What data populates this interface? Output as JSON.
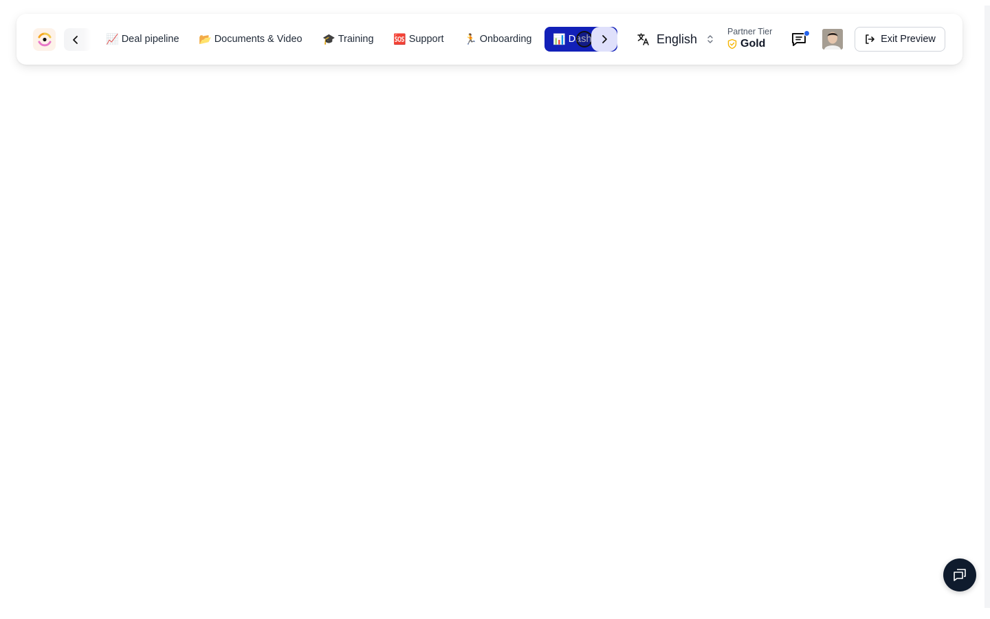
{
  "nav": {
    "items": [
      {
        "emoji": "📈",
        "label": "Deal pipeline",
        "icon": "chart-increasing-emoji"
      },
      {
        "emoji": "📂",
        "label": "Documents & Video",
        "icon": "folder-emoji"
      },
      {
        "emoji": "🎓",
        "label": "Training",
        "icon": "graduation-cap-emoji"
      },
      {
        "emoji": "🆘",
        "label": "Support",
        "icon": "sos-emoji"
      },
      {
        "emoji": "🏃",
        "label": "Onboarding",
        "icon": "runner-emoji"
      }
    ],
    "active": {
      "emoji": "📊",
      "label": "Dash",
      "icon": "bar-chart-emoji"
    }
  },
  "language": {
    "selected": "English"
  },
  "partner": {
    "label": "Partner Tier",
    "value": "Gold"
  },
  "header": {
    "exit_label": "Exit Preview"
  },
  "colors": {
    "accent": "#1220b8",
    "next_button_bg": "#dfe0fb",
    "notification_dot": "#2563eb",
    "gold": "#f5b400",
    "fab_bg": "#0f1b2d"
  }
}
